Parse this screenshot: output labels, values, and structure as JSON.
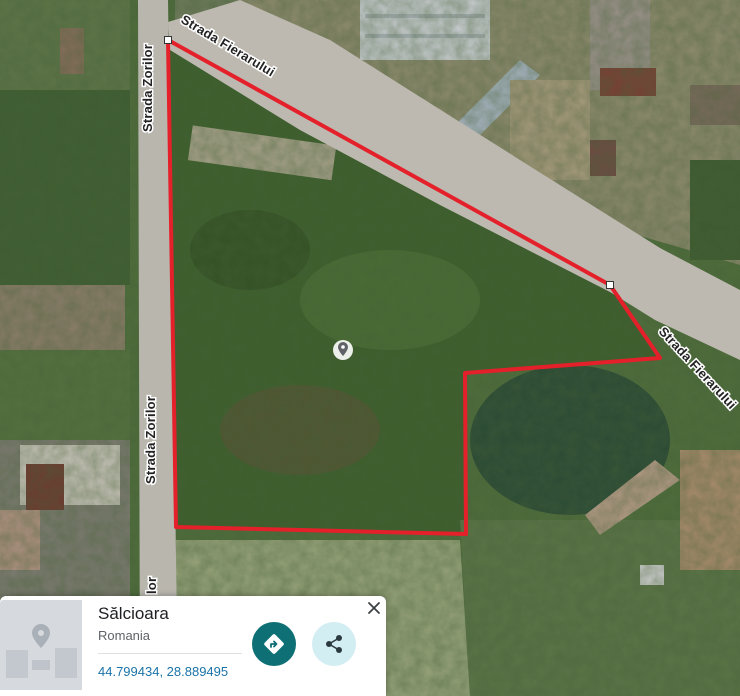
{
  "map": {
    "type": "satellite",
    "boundary_color": "#e4202a",
    "roads": [
      {
        "id": "zorilor-top",
        "label": "Strada Zorilor"
      },
      {
        "id": "fierarului-top",
        "label": "Strada Fierarului"
      },
      {
        "id": "zorilor-mid",
        "label": "Strada Zorilor"
      },
      {
        "id": "fierarului-right",
        "label": "Strada Fierarului"
      },
      {
        "id": "zorilor-bottom",
        "label": "lor"
      }
    ],
    "marker_icon": "location-pin-icon"
  },
  "place_card": {
    "name": "Sălcioara",
    "region": "Romania",
    "coordinates": "44.799434, 28.889495",
    "directions_icon": "directions-icon",
    "share_icon": "share-icon",
    "close_icon": "close-icon",
    "accent_color": "#0e6f74"
  }
}
